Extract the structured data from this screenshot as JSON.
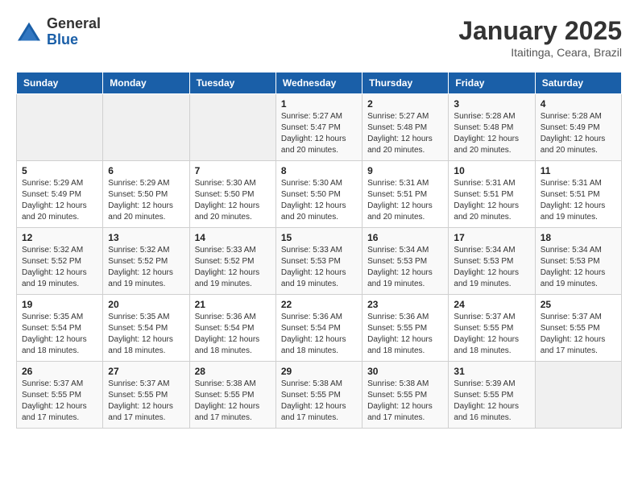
{
  "header": {
    "logo_general": "General",
    "logo_blue": "Blue",
    "month_year": "January 2025",
    "location": "Itaitinga, Ceara, Brazil"
  },
  "days_of_week": [
    "Sunday",
    "Monday",
    "Tuesday",
    "Wednesday",
    "Thursday",
    "Friday",
    "Saturday"
  ],
  "weeks": [
    [
      {
        "day": "",
        "info": ""
      },
      {
        "day": "",
        "info": ""
      },
      {
        "day": "",
        "info": ""
      },
      {
        "day": "1",
        "info": "Sunrise: 5:27 AM\nSunset: 5:47 PM\nDaylight: 12 hours\nand 20 minutes."
      },
      {
        "day": "2",
        "info": "Sunrise: 5:27 AM\nSunset: 5:48 PM\nDaylight: 12 hours\nand 20 minutes."
      },
      {
        "day": "3",
        "info": "Sunrise: 5:28 AM\nSunset: 5:48 PM\nDaylight: 12 hours\nand 20 minutes."
      },
      {
        "day": "4",
        "info": "Sunrise: 5:28 AM\nSunset: 5:49 PM\nDaylight: 12 hours\nand 20 minutes."
      }
    ],
    [
      {
        "day": "5",
        "info": "Sunrise: 5:29 AM\nSunset: 5:49 PM\nDaylight: 12 hours\nand 20 minutes."
      },
      {
        "day": "6",
        "info": "Sunrise: 5:29 AM\nSunset: 5:50 PM\nDaylight: 12 hours\nand 20 minutes."
      },
      {
        "day": "7",
        "info": "Sunrise: 5:30 AM\nSunset: 5:50 PM\nDaylight: 12 hours\nand 20 minutes."
      },
      {
        "day": "8",
        "info": "Sunrise: 5:30 AM\nSunset: 5:50 PM\nDaylight: 12 hours\nand 20 minutes."
      },
      {
        "day": "9",
        "info": "Sunrise: 5:31 AM\nSunset: 5:51 PM\nDaylight: 12 hours\nand 20 minutes."
      },
      {
        "day": "10",
        "info": "Sunrise: 5:31 AM\nSunset: 5:51 PM\nDaylight: 12 hours\nand 20 minutes."
      },
      {
        "day": "11",
        "info": "Sunrise: 5:31 AM\nSunset: 5:51 PM\nDaylight: 12 hours\nand 19 minutes."
      }
    ],
    [
      {
        "day": "12",
        "info": "Sunrise: 5:32 AM\nSunset: 5:52 PM\nDaylight: 12 hours\nand 19 minutes."
      },
      {
        "day": "13",
        "info": "Sunrise: 5:32 AM\nSunset: 5:52 PM\nDaylight: 12 hours\nand 19 minutes."
      },
      {
        "day": "14",
        "info": "Sunrise: 5:33 AM\nSunset: 5:52 PM\nDaylight: 12 hours\nand 19 minutes."
      },
      {
        "day": "15",
        "info": "Sunrise: 5:33 AM\nSunset: 5:53 PM\nDaylight: 12 hours\nand 19 minutes."
      },
      {
        "day": "16",
        "info": "Sunrise: 5:34 AM\nSunset: 5:53 PM\nDaylight: 12 hours\nand 19 minutes."
      },
      {
        "day": "17",
        "info": "Sunrise: 5:34 AM\nSunset: 5:53 PM\nDaylight: 12 hours\nand 19 minutes."
      },
      {
        "day": "18",
        "info": "Sunrise: 5:34 AM\nSunset: 5:53 PM\nDaylight: 12 hours\nand 19 minutes."
      }
    ],
    [
      {
        "day": "19",
        "info": "Sunrise: 5:35 AM\nSunset: 5:54 PM\nDaylight: 12 hours\nand 18 minutes."
      },
      {
        "day": "20",
        "info": "Sunrise: 5:35 AM\nSunset: 5:54 PM\nDaylight: 12 hours\nand 18 minutes."
      },
      {
        "day": "21",
        "info": "Sunrise: 5:36 AM\nSunset: 5:54 PM\nDaylight: 12 hours\nand 18 minutes."
      },
      {
        "day": "22",
        "info": "Sunrise: 5:36 AM\nSunset: 5:54 PM\nDaylight: 12 hours\nand 18 minutes."
      },
      {
        "day": "23",
        "info": "Sunrise: 5:36 AM\nSunset: 5:55 PM\nDaylight: 12 hours\nand 18 minutes."
      },
      {
        "day": "24",
        "info": "Sunrise: 5:37 AM\nSunset: 5:55 PM\nDaylight: 12 hours\nand 18 minutes."
      },
      {
        "day": "25",
        "info": "Sunrise: 5:37 AM\nSunset: 5:55 PM\nDaylight: 12 hours\nand 17 minutes."
      }
    ],
    [
      {
        "day": "26",
        "info": "Sunrise: 5:37 AM\nSunset: 5:55 PM\nDaylight: 12 hours\nand 17 minutes."
      },
      {
        "day": "27",
        "info": "Sunrise: 5:37 AM\nSunset: 5:55 PM\nDaylight: 12 hours\nand 17 minutes."
      },
      {
        "day": "28",
        "info": "Sunrise: 5:38 AM\nSunset: 5:55 PM\nDaylight: 12 hours\nand 17 minutes."
      },
      {
        "day": "29",
        "info": "Sunrise: 5:38 AM\nSunset: 5:55 PM\nDaylight: 12 hours\nand 17 minutes."
      },
      {
        "day": "30",
        "info": "Sunrise: 5:38 AM\nSunset: 5:55 PM\nDaylight: 12 hours\nand 17 minutes."
      },
      {
        "day": "31",
        "info": "Sunrise: 5:39 AM\nSunset: 5:55 PM\nDaylight: 12 hours\nand 16 minutes."
      },
      {
        "day": "",
        "info": ""
      }
    ]
  ]
}
